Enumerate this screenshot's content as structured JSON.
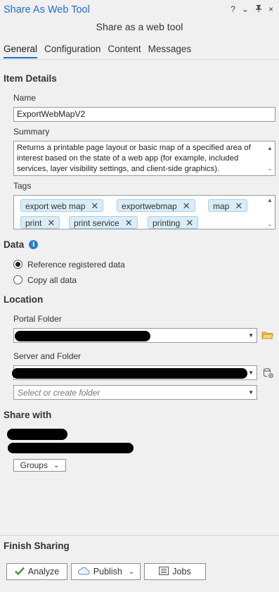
{
  "pane": {
    "title": "Share As Web Tool",
    "subtitle": "Share as a web tool",
    "controls": [
      "?",
      "⌄",
      "⊤",
      "×"
    ]
  },
  "tabs": [
    {
      "label": "General"
    },
    {
      "label": "Configuration"
    },
    {
      "label": "Content"
    },
    {
      "label": "Messages"
    }
  ],
  "item_details": {
    "heading": "Item Details",
    "name_label": "Name",
    "name_value": "ExportWebMapV2",
    "summary_label": "Summary",
    "summary_value": "Returns a printable page layout or basic map of a specified area of interest based on the state of a web app (for example, included services, layer visibility settings, and client-side graphics).",
    "tags_label": "Tags",
    "tags": [
      "export web map",
      "exportwebmap",
      "map",
      "print",
      "print service",
      "printing"
    ]
  },
  "data": {
    "heading": "Data",
    "options": [
      "Reference registered data",
      "Copy all data"
    ],
    "selected_index": 0
  },
  "location": {
    "heading": "Location",
    "portal_folder_label": "Portal Folder",
    "server_folder_label": "Server and Folder",
    "folder_placeholder": "Select or create folder"
  },
  "share_with": {
    "heading": "Share with",
    "groups_button": "Groups"
  },
  "finish": {
    "heading": "Finish Sharing",
    "analyze_label": "Analyze",
    "publish_label": "Publish",
    "jobs_label": "Jobs"
  },
  "colors": {
    "accent": "#1e6ec8",
    "chip_bg": "#d9ecf7",
    "analyze_check": "#2e8b3a"
  }
}
